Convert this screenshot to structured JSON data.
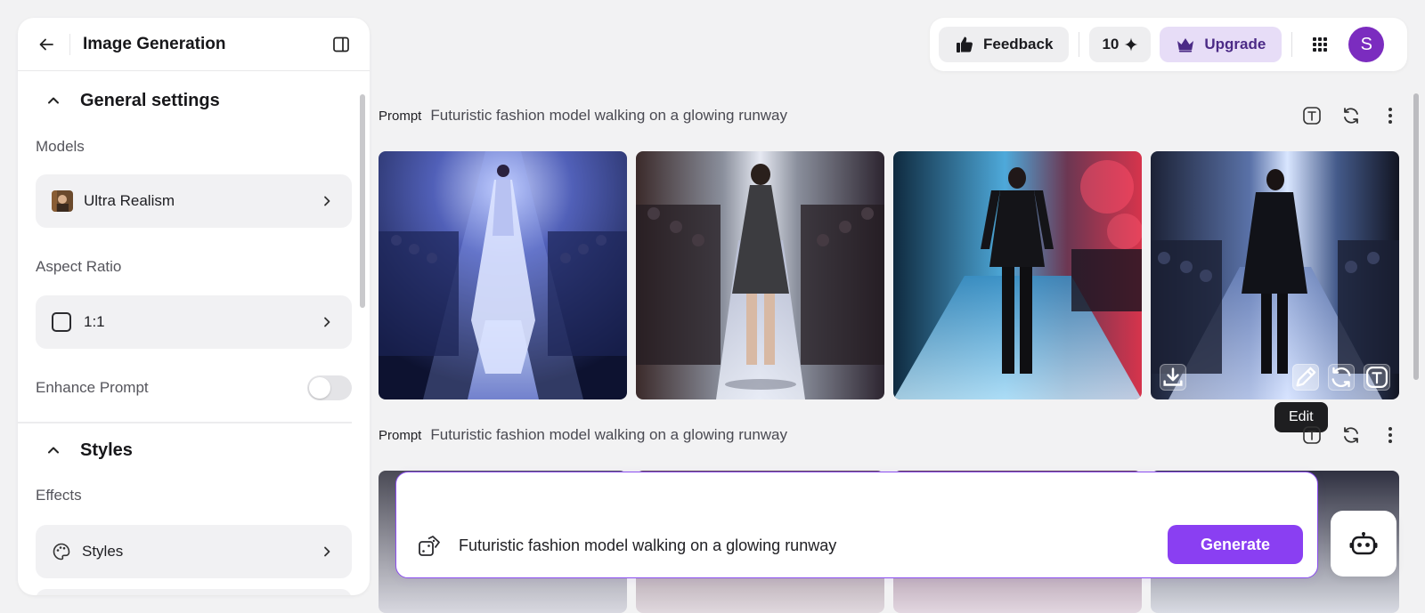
{
  "panel": {
    "title": "Image Generation",
    "general_settings": {
      "title": "General settings",
      "models_label": "Models",
      "model_value": "Ultra Realism",
      "aspect_label": "Aspect Ratio",
      "aspect_value": "1:1",
      "enhance_label": "Enhance Prompt",
      "enhance_on": false
    },
    "styles": {
      "title": "Styles",
      "effects_label": "Effects",
      "styles_value": "Styles"
    }
  },
  "topbar": {
    "feedback_label": "Feedback",
    "credits": "10",
    "upgrade_label": "Upgrade",
    "avatar_initial": "S"
  },
  "prompts": [
    {
      "tag": "Prompt",
      "text": "Futuristic fashion model walking on a glowing runway"
    },
    {
      "tag": "Prompt",
      "text": "Futuristic fashion model walking on a glowing runway"
    }
  ],
  "tooltip": "Edit",
  "composer": {
    "text": "Futuristic fashion model walking on a glowing runway",
    "generate_label": "Generate"
  },
  "colors": {
    "accent": "#8a3ff2",
    "avatar": "#7b2cbf",
    "upgrade_bg": "#e7ddf7"
  },
  "icons": {
    "back": "arrow-left-icon",
    "panel_toggle": "sidebar-toggle-icon",
    "feedback": "thumbs-up-icon",
    "credits": "sparkle-icon",
    "upgrade": "crown-icon",
    "apps": "grid-icon",
    "text": "text-box-icon",
    "regenerate": "refresh-icon",
    "more": "more-vertical-icon",
    "download": "download-icon",
    "edit": "pencil-icon",
    "dice": "dice-icon",
    "bot": "bot-icon"
  }
}
